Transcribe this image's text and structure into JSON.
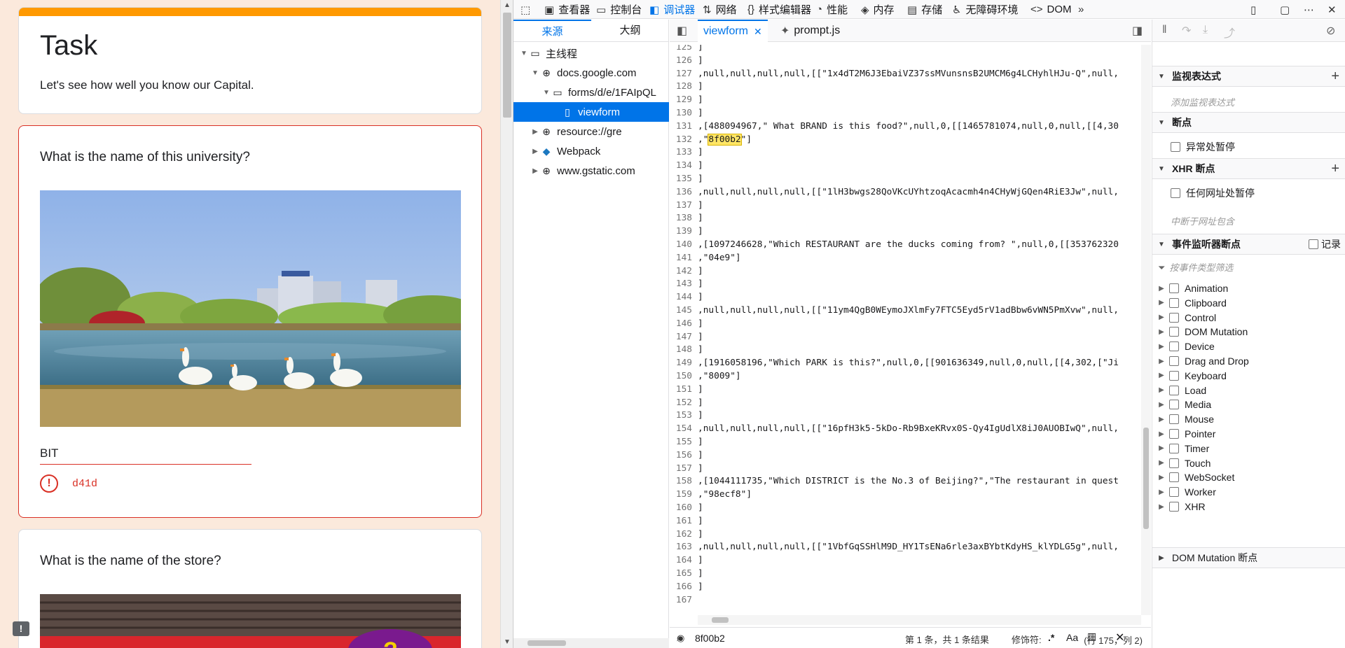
{
  "form": {
    "task_title": "Task",
    "task_description": "Let's see how well you know our Capital.",
    "q1": {
      "title": "What is the name of this university?",
      "answer": "BIT",
      "error": "d41d"
    },
    "q2": {
      "title": "What is the name of the store?"
    },
    "feedback_icon": "feedback-icon",
    "colors": {
      "header_accent": "#ff9900",
      "error": "#d93025",
      "background": "#fbe9dc"
    }
  },
  "devtools": {
    "tabs": [
      {
        "label": "查看器",
        "icon": "inspector-icon"
      },
      {
        "label": "控制台",
        "icon": "console-icon"
      },
      {
        "label": "调试器",
        "icon": "debugger-icon",
        "active": true
      },
      {
        "label": "网络",
        "icon": "network-icon"
      },
      {
        "label": "样式编辑器",
        "icon": "style-editor-icon"
      },
      {
        "label": "性能",
        "icon": "performance-icon"
      },
      {
        "label": "内存",
        "icon": "memory-icon"
      },
      {
        "label": "存储",
        "icon": "storage-icon"
      },
      {
        "label": "无障碍环境",
        "icon": "accessibility-icon"
      },
      {
        "label": "DOM",
        "icon": "dom-icon"
      }
    ],
    "navigator": {
      "tabs": [
        "来源",
        "大纲"
      ],
      "tree": [
        {
          "label": "主线程",
          "icon": "window-icon"
        },
        {
          "label": "docs.google.com",
          "icon": "globe-icon"
        },
        {
          "label": "forms/d/e/1FAIpQL",
          "icon": "folder-icon"
        },
        {
          "label": "viewform",
          "icon": "file-icon"
        },
        {
          "label": "resource://gre",
          "icon": "globe-icon"
        },
        {
          "label": "Webpack",
          "icon": "webpack-icon"
        },
        {
          "label": "www.gstatic.com",
          "icon": "globe-icon"
        }
      ]
    },
    "editor": {
      "tabs": [
        {
          "label": "viewform",
          "active": true
        },
        {
          "label": "prompt.js"
        }
      ],
      "lines": [
        {
          "n": "125",
          "t": "]"
        },
        {
          "n": "126",
          "t": "]"
        },
        {
          "n": "127",
          "t": ",null,null,null,null,[[\"1x4dT2M6J3EbaiVZ37ssMVunsnsB2UMCM6g4LCHyhlHJu-Q\",null,"
        },
        {
          "n": "128",
          "t": "]"
        },
        {
          "n": "129",
          "t": "]"
        },
        {
          "n": "130",
          "t": "]"
        },
        {
          "n": "131",
          "t": ",[488094967,\" What BRAND is this food?\",null,0,[[1465781074,null,0,null,[[4,30"
        },
        {
          "n": "132",
          "pre": ",\"",
          "hl": "8f00b2",
          "post": "\"]"
        },
        {
          "n": "133",
          "t": "]"
        },
        {
          "n": "134",
          "t": "]"
        },
        {
          "n": "135",
          "t": "]"
        },
        {
          "n": "136",
          "t": ",null,null,null,null,[[\"1lH3bwgs28QoVKcUYhtzoqAcacmh4n4CHyWjGQen4RiE3Jw\",null,"
        },
        {
          "n": "137",
          "t": "]"
        },
        {
          "n": "138",
          "t": "]"
        },
        {
          "n": "139",
          "t": "]"
        },
        {
          "n": "140",
          "t": ",[1097246628,\"Which RESTAURANT are the ducks coming from? \",null,0,[[353762320"
        },
        {
          "n": "141",
          "t": ",\"04e9\"]"
        },
        {
          "n": "142",
          "t": "]"
        },
        {
          "n": "143",
          "t": "]"
        },
        {
          "n": "144",
          "t": "]"
        },
        {
          "n": "145",
          "t": ",null,null,null,null,[[\"11ym4QgB0WEymoJXlmFy7FTC5Eyd5rV1adBbw6vWN5PmXvw\",null,"
        },
        {
          "n": "146",
          "t": "]"
        },
        {
          "n": "147",
          "t": "]"
        },
        {
          "n": "148",
          "t": "]"
        },
        {
          "n": "149",
          "t": ",[1916058196,\"Which PARK is this?\",null,0,[[901636349,null,0,null,[[4,302,[\"Ji"
        },
        {
          "n": "150",
          "t": ",\"8009\"]"
        },
        {
          "n": "151",
          "t": "]"
        },
        {
          "n": "152",
          "t": "]"
        },
        {
          "n": "153",
          "t": "]"
        },
        {
          "n": "154",
          "t": ",null,null,null,null,[[\"16pfH3k5-5kDo-Rb9BxeKRvx0S-Qy4IgUdlX8iJ0AUOBIwQ\",null,"
        },
        {
          "n": "155",
          "t": "]"
        },
        {
          "n": "156",
          "t": "]"
        },
        {
          "n": "157",
          "t": "]"
        },
        {
          "n": "158",
          "t": ",[1044111735,\"Which DISTRICT is the No.3 of Beijing?\",\"The restaurant in quest"
        },
        {
          "n": "159",
          "t": ",\"98ecf8\"]"
        },
        {
          "n": "160",
          "t": "]"
        },
        {
          "n": "161",
          "t": "]"
        },
        {
          "n": "162",
          "t": "]"
        },
        {
          "n": "163",
          "t": ",null,null,null,null,[[\"1VbfGqSSHlM9D_HY1TsENa6rle3axBYbtKdyHS_klYDLG5g\",null,"
        },
        {
          "n": "164",
          "t": "]"
        },
        {
          "n": "165",
          "t": "]"
        },
        {
          "n": "166",
          "t": "]"
        },
        {
          "n": "167",
          "t": ""
        }
      ]
    },
    "search": {
      "value": "8f00b2",
      "results": "第 1 条，共 1 条结果",
      "modifiers_label": "修饰符:",
      "regex": ".*",
      "case": "Aa"
    },
    "status": {
      "position": "(行 175，列 2)"
    },
    "debugger": {
      "watch": {
        "title": "监视表达式",
        "placeholder": "添加监视表达式"
      },
      "breakpoints": {
        "title": "断点",
        "pause_exceptions": "异常处暂停"
      },
      "xhr": {
        "title": "XHR 断点",
        "any_url": "任何网址处暂停",
        "placeholder": "中断于网址包含"
      },
      "events": {
        "title": "事件监听器断点",
        "log_label": "记录",
        "filter_placeholder": "按事件类型筛选",
        "items": [
          "Animation",
          "Clipboard",
          "Control",
          "DOM Mutation",
          "Device",
          "Drag and Drop",
          "Keyboard",
          "Load",
          "Media",
          "Mouse",
          "Pointer",
          "Timer",
          "Touch",
          "WebSocket",
          "Worker",
          "XHR"
        ]
      },
      "dom_mutation": {
        "title": "DOM Mutation 断点"
      }
    }
  }
}
